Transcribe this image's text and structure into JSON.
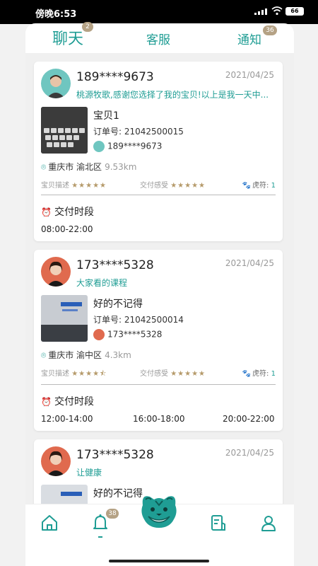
{
  "status_bar": {
    "time": "傍晚6:53",
    "battery": "66"
  },
  "tabs": [
    {
      "label": "聊天",
      "badge": "2"
    },
    {
      "label": "客服",
      "badge": ""
    },
    {
      "label": "通知",
      "badge": "36"
    }
  ],
  "cards": [
    {
      "phone": "189****9673",
      "date": "2021/04/25",
      "message": "桃源牧歌,感谢您选择了我的宝贝!以上是我一天中...",
      "product_title": "宝贝1",
      "order_label": "订单号:",
      "order_no": "21042500015",
      "buyer": "189****9673",
      "city": "重庆市",
      "district": "渝北区",
      "distance": "9.53km",
      "rate1_label": "宝贝描述",
      "rate1_stars": "★★★★★",
      "rate2_label": "交付感受",
      "rate2_stars": "★★★★★",
      "hu_label": "虎符:",
      "hu_value": "1",
      "section_title": "交付时段",
      "slots": [
        "08:00-22:00"
      ]
    },
    {
      "phone": "173****5328",
      "date": "2021/04/25",
      "message": "大家看的课程",
      "product_title": "好的不记得",
      "order_label": "订单号:",
      "order_no": "21042500014",
      "buyer": "173****5328",
      "city": "重庆市",
      "district": "渝中区",
      "distance": "4.3km",
      "rate1_label": "宝贝描述",
      "rate1_stars": "★★★★⯪",
      "rate2_label": "交付感受",
      "rate2_stars": "★★★★★",
      "hu_label": "虎符:",
      "hu_value": "1",
      "section_title": "交付时段",
      "slots": [
        "12:00-14:00",
        "16:00-18:00",
        "20:00-22:00"
      ]
    },
    {
      "phone": "173****5328",
      "date": "2021/04/25",
      "message": "让健康",
      "product_title": "好的不记得"
    }
  ],
  "bottom_nav": {
    "bell_badge": "38"
  },
  "colors": {
    "accent": "#1f9d94",
    "badge": "#b5a285"
  }
}
